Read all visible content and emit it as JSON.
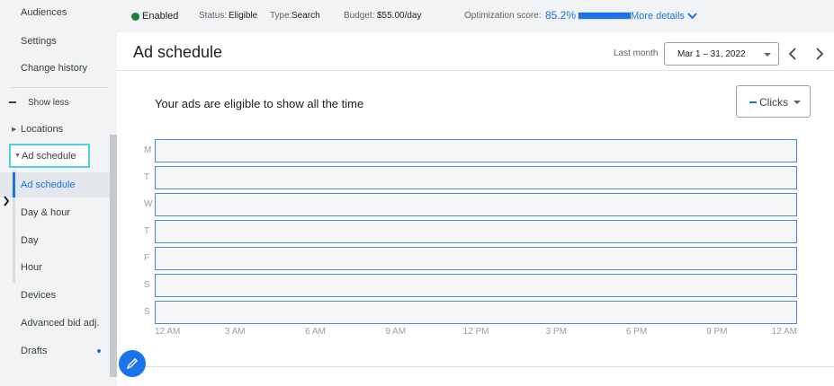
{
  "sidebar": {
    "items": [
      {
        "label": "Audiences"
      },
      {
        "label": "Settings"
      },
      {
        "label": "Change history"
      },
      {
        "label": "Show less"
      },
      {
        "label": "Locations"
      },
      {
        "label": "Ad schedule"
      },
      {
        "label": "Ad schedule"
      },
      {
        "label": "Day & hour"
      },
      {
        "label": "Day"
      },
      {
        "label": "Hour"
      },
      {
        "label": "Devices"
      },
      {
        "label": "Advanced bid adj."
      },
      {
        "label": "Drafts"
      }
    ]
  },
  "status_bar": {
    "enabled": "Enabled",
    "status_label": "Status:",
    "status_value": "Eligible",
    "type_label": "Type:",
    "type_value": "Search",
    "budget_label": "Budget:",
    "budget_value": "$55.00/day",
    "optimization_label": "Optimization score:",
    "optimization_value": "85.2%",
    "optimization_fraction": 0.852,
    "more_details": "More details"
  },
  "header": {
    "title": "Ad schedule",
    "last_month": "Last month",
    "date_range": "Mar 1 – 31, 2022"
  },
  "card": {
    "message": "Your ads are eligible to show all the time",
    "metric": "Clicks"
  },
  "schedule": {
    "days": [
      "M",
      "T",
      "W",
      "T",
      "F",
      "S",
      "S"
    ],
    "hours": [
      "12 AM",
      "3 AM",
      "6 AM",
      "9 AM",
      "12 PM",
      "3 PM",
      "6 PM",
      "9 PM",
      "12 AM"
    ]
  },
  "colors": {
    "accent": "#1a73e8",
    "enabled_green": "#188038",
    "selection_outline": "#4dd0e1"
  }
}
